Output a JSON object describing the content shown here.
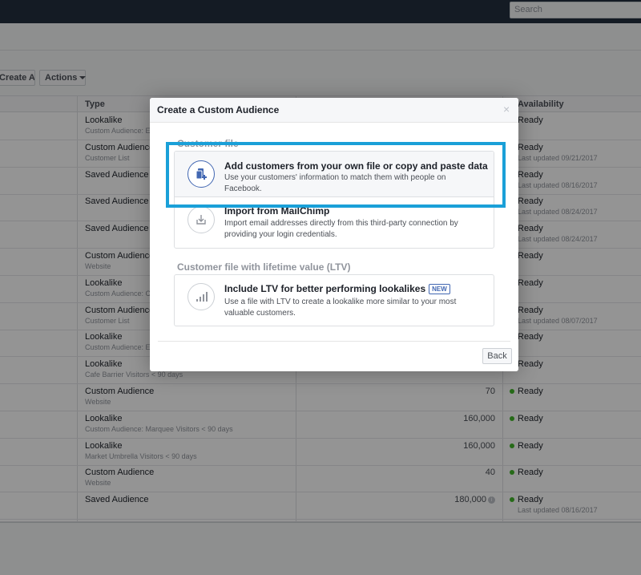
{
  "topbar": {
    "search_placeholder": "Search"
  },
  "toolbar": {
    "create_ad_label": "Create Ad",
    "actions_label": "Actions"
  },
  "table": {
    "headers": {
      "type": "Type",
      "availability": "Availability"
    },
    "rows": [
      {
        "type": "Lookalike",
        "subtype": "Custom Audience: En",
        "size": "",
        "status": "Ready",
        "updated": ""
      },
      {
        "type": "Custom Audience",
        "subtype": "Customer List",
        "size": "",
        "status": "Ready",
        "updated": "Last updated 09/21/2017"
      },
      {
        "type": "Saved Audience",
        "subtype": "",
        "size": "",
        "status": "Ready",
        "updated": "Last updated 08/16/2017"
      },
      {
        "type": "Saved Audience",
        "subtype": "",
        "size": "",
        "status": "Ready",
        "updated": "Last updated 08/24/2017"
      },
      {
        "type": "Saved Audience",
        "subtype": "",
        "size": "",
        "status": "Ready",
        "updated": "Last updated 08/24/2017"
      },
      {
        "type": "Custom Audience",
        "subtype": "Website",
        "size": "",
        "status": "Ready",
        "updated": ""
      },
      {
        "type": "Lookalike",
        "subtype": "Custom Audience: Co",
        "size": "",
        "status": "Ready",
        "updated": ""
      },
      {
        "type": "Custom Audience",
        "subtype": "Customer List",
        "size": "",
        "status": "Ready",
        "updated": "Last updated 08/07/2017"
      },
      {
        "type": "Lookalike",
        "subtype": "Custom Audience: Ex",
        "size": "",
        "status": "Ready",
        "updated": ""
      },
      {
        "type": "Lookalike",
        "subtype": "Cafe Barrier Visitors < 90 days",
        "size": "",
        "status": "Ready",
        "updated": ""
      },
      {
        "type": "Custom Audience",
        "subtype": "Website",
        "size": "70",
        "status": "Ready",
        "updated": ""
      },
      {
        "type": "Lookalike",
        "subtype": "Custom Audience: Marquee Visitors < 90 days",
        "size": "160,000",
        "status": "Ready",
        "updated": ""
      },
      {
        "type": "Lookalike",
        "subtype": "Market Umbrella Visitors < 90 days",
        "size": "160,000",
        "status": "Ready",
        "updated": ""
      },
      {
        "type": "Custom Audience",
        "subtype": "Website",
        "size": "40",
        "status": "Ready",
        "updated": ""
      },
      {
        "type": "Saved Audience",
        "subtype": "",
        "size": "180,000",
        "status": "Ready",
        "updated": "Last updated 08/16/2017"
      }
    ]
  },
  "modal": {
    "title": "Create a Custom Audience",
    "close_glyph": "×",
    "section_customer_file": "Customer file",
    "section_ltv": "Customer file with lifetime value (LTV)",
    "options": [
      {
        "title": "Add customers from your own file or copy and paste data",
        "desc": "Use your customers' information to match them with people on Facebook.",
        "icon": "document-plus-icon"
      },
      {
        "title": "Import from MailChimp",
        "desc": "Import email addresses directly from this third-party connection by providing your login credentials.",
        "icon": "import-icon"
      },
      {
        "title": "Include LTV for better performing lookalikes",
        "badge": "NEW",
        "desc": "Use a file with LTV to create a lookalike more similar to your most valuable customers.",
        "icon": "bar-chart-icon"
      }
    ],
    "back_label": "Back"
  },
  "colors": {
    "highlight": "#1aa0d8",
    "accent": "#4267b2",
    "ready_dot": "#42b72a"
  }
}
